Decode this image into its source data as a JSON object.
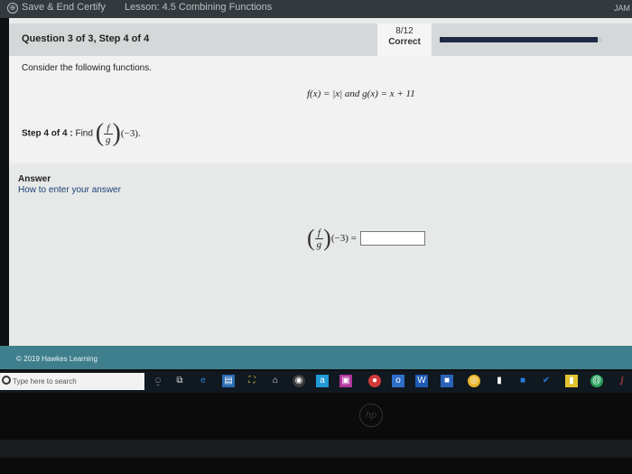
{
  "topbar": {
    "save_label": "Save & End Certify",
    "lesson_label": "Lesson: 4.5 Combining Functions",
    "user_label": "JAM"
  },
  "question": {
    "title": "Question 3 of 3, Step 4 of 4",
    "score": "8/12",
    "status": "Correct",
    "progress_fraction": 0.97
  },
  "problem": {
    "prompt": "Consider the following functions.",
    "functions": "f(x) = |x| and g(x) = x + 11",
    "step_label": "Step 4 of 4 :",
    "step_instruction": "Find",
    "frac_num": "f",
    "frac_den": "g",
    "argument": "(−3)."
  },
  "answer": {
    "label": "Answer",
    "howto": "How to enter your answer",
    "frac_num": "f",
    "frac_den": "g",
    "argument": "(−3) =",
    "value": ""
  },
  "footer": {
    "copyright": "© 2019 Hawkes Learning"
  },
  "taskbar": {
    "search_placeholder": "Type here to search"
  },
  "bezel": {
    "logo": "hp"
  }
}
